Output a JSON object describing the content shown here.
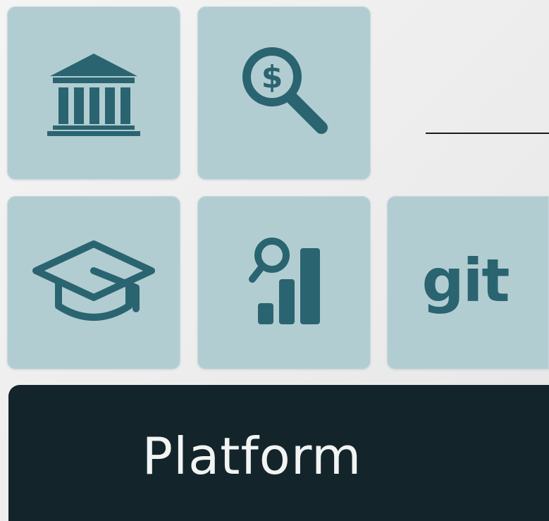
{
  "tiles": [
    {
      "id": "bank",
      "icon": "bank-icon"
    },
    {
      "id": "financial-search",
      "icon": "dollar-magnifier-icon"
    },
    {
      "id": "education",
      "icon": "graduation-cap-icon"
    },
    {
      "id": "analytics",
      "icon": "search-bar-chart-icon"
    },
    {
      "id": "git",
      "icon": "git-icon",
      "label": "git"
    }
  ],
  "platform": {
    "label": "Platform"
  },
  "colors": {
    "tile_background": "#b2cdd1",
    "icon": "#2a6470",
    "platform_background": "#13252b",
    "platform_text": "#f2f4f4",
    "page_background": "#efefef"
  }
}
